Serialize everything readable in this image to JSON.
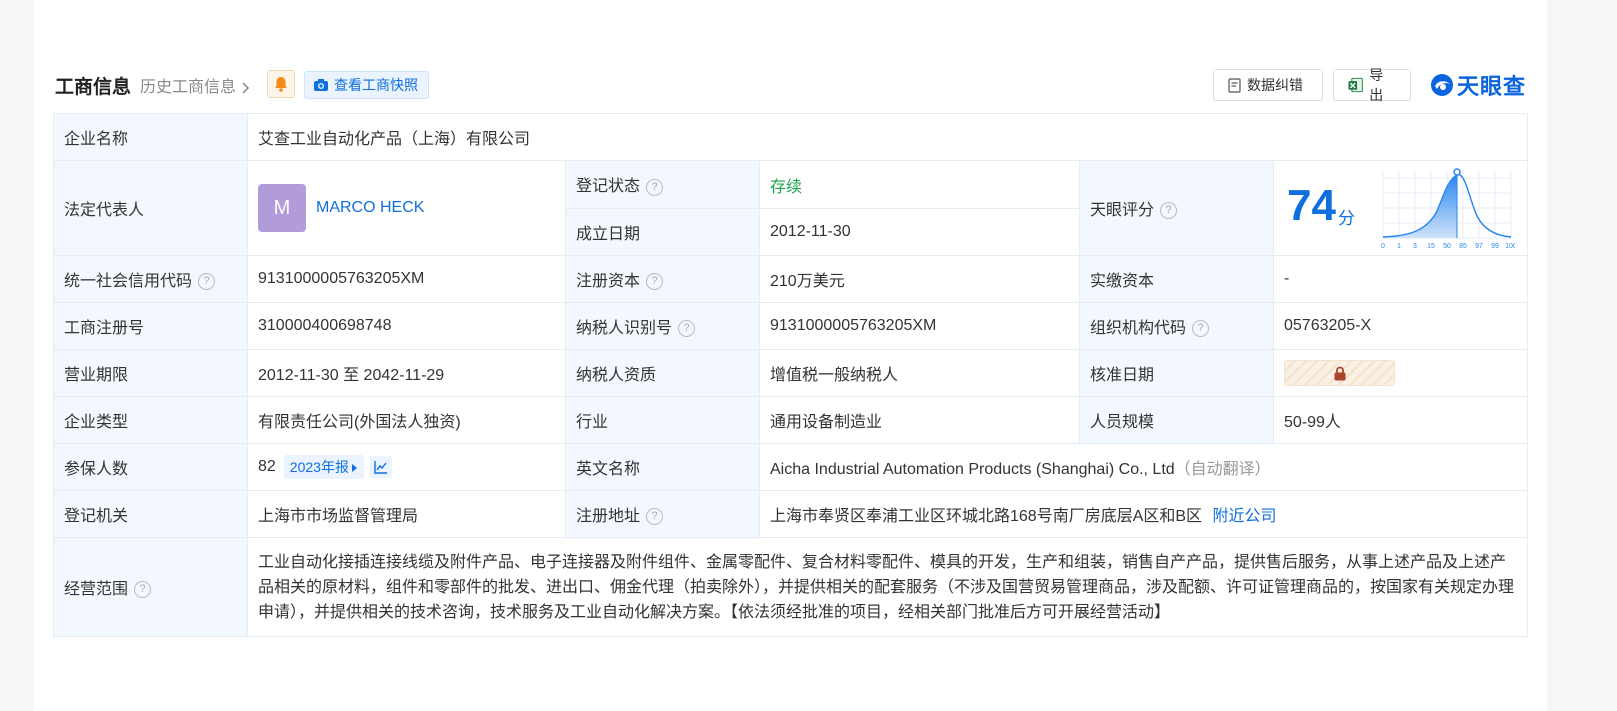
{
  "header": {
    "title": "工商信息",
    "history_link": "历史工商信息",
    "snapshot_button": "查看工商快照",
    "correct_button": "数据纠错",
    "export_button": "导出",
    "logo_text": "天眼查"
  },
  "table": {
    "company_name_label": "企业名称",
    "company_name": "艾查工业自动化产品（上海）有限公司",
    "legal_rep_label": "法定代表人",
    "legal_rep_avatar": "M",
    "legal_rep_name": "MARCO HECK",
    "reg_status_label": "登记状态",
    "reg_status": "存续",
    "est_date_label": "成立日期",
    "est_date": "2012-11-30",
    "score_label": "天眼评分",
    "score_value": "74",
    "score_unit": "分",
    "score_ticks": [
      "0",
      "1",
      "3",
      "15",
      "50",
      "85",
      "97",
      "99",
      "100"
    ],
    "credit_code_label": "统一社会信用代码",
    "credit_code": "9131000005763205XM",
    "reg_capital_label": "注册资本",
    "reg_capital": "210万美元",
    "paid_capital_label": "实缴资本",
    "paid_capital": "-",
    "reg_no_label": "工商注册号",
    "reg_no": "310000400698748",
    "taxpayer_id_label": "纳税人识别号",
    "taxpayer_id": "9131000005763205XM",
    "org_code_label": "组织机构代码",
    "org_code": "05763205-X",
    "term_label": "营业期限",
    "term": "2012-11-30 至 2042-11-29",
    "taxpayer_qual_label": "纳税人资质",
    "taxpayer_qual": "增值税一般纳税人",
    "approval_date_label": "核准日期",
    "company_type_label": "企业类型",
    "company_type": "有限责任公司(外国法人独资)",
    "industry_label": "行业",
    "industry": "通用设备制造业",
    "staff_size_label": "人员规模",
    "staff_size": "50-99人",
    "insured_label": "参保人数",
    "insured_count": "82",
    "insured_report_tag": "2023年报",
    "english_name_label": "英文名称",
    "english_name": "Aicha Industrial Automation Products (Shanghai) Co., Ltd",
    "english_name_note": "（自动翻译）",
    "authority_label": "登记机关",
    "authority": "上海市市场监督管理局",
    "address_label": "注册地址",
    "address": "上海市奉贤区奉浦工业区环城北路168号南厂房底层A区和B区",
    "nearby_link": "附近公司",
    "scope_label": "经营范围",
    "scope": "工业自动化接插连接线缆及附件产品、电子连接器及附件组件、金属零配件、复合材料零配件、模具的开发，生产和组装，销售自产产品，提供售后服务，从事上述产品及上述产品相关的原材料，组件和零部件的批发、进出口、佣金代理（拍卖除外），并提供相关的配套服务（不涉及国营贸易管理商品，涉及配额、许可证管理商品的，按国家有关规定办理申请），并提供相关的技术咨询，技术服务及工业自动化解决方案。【依法须经批准的项目，经相关部门批准后方可开展经营活动】"
  },
  "colors": {
    "brand_blue": "#0f6fde",
    "status_green": "#1aa64b",
    "label_bg": "#f3f8fe",
    "avatar_purple": "#b19cd9"
  },
  "icons": [
    "bell-icon",
    "camera-icon",
    "chevron-right-icon",
    "document-icon",
    "excel-icon",
    "tianyancha-logo-icon",
    "help-icon",
    "lock-icon",
    "trend-chart-icon",
    "play-triangle-icon"
  ]
}
